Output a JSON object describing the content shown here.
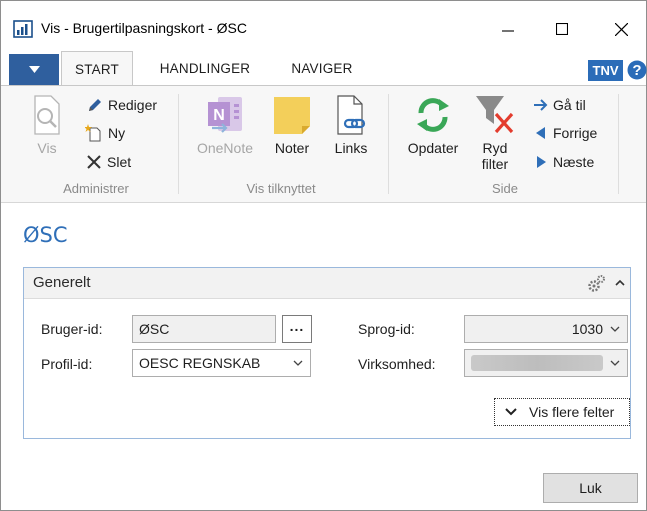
{
  "window": {
    "title": "Vis - Brugertilpasningskort - ØSC",
    "app_icon": "dynamics-nav-icon",
    "controls": [
      "minimize-icon",
      "maximize-icon",
      "close-icon"
    ]
  },
  "ribbon_tabs": {
    "menu_icon": "chevron-down-icon",
    "tabs": [
      {
        "label": "START",
        "active": true
      },
      {
        "label": "HANDLINGER",
        "active": false
      },
      {
        "label": "NAVIGER",
        "active": false
      }
    ],
    "user_initials": "TNV",
    "help_icon": "question-icon"
  },
  "ribbon": {
    "groups": [
      {
        "label": "Administrer",
        "actions": [
          {
            "label": "Vis",
            "icon": "view-magnifier-icon",
            "enabled": false
          },
          {
            "label": "Rediger",
            "icon": "pencil-icon",
            "enabled": true
          },
          {
            "label": "Ny",
            "icon": "new-document-icon",
            "enabled": true
          },
          {
            "label": "Slet",
            "icon": "delete-x-icon",
            "enabled": true
          }
        ]
      },
      {
        "label": "Vis tilknyttet",
        "actions": [
          {
            "label": "OneNote",
            "icon": "onenote-icon",
            "enabled": false
          },
          {
            "label": "Noter",
            "icon": "note-icon",
            "enabled": true
          },
          {
            "label": "Links",
            "icon": "link-document-icon",
            "enabled": true
          }
        ]
      },
      {
        "label": "Side",
        "actions": [
          {
            "label": "Opdater",
            "icon": "refresh-icon",
            "enabled": true
          },
          {
            "label": "Ryd filter",
            "label_line1": "Ryd",
            "label_line2": "filter",
            "icon": "clear-filter-icon",
            "enabled": true
          },
          {
            "label": "Gå til",
            "icon": "arrow-right-icon",
            "enabled": true
          },
          {
            "label": "Forrige",
            "icon": "triangle-left-icon",
            "enabled": true
          },
          {
            "label": "Næste",
            "icon": "triangle-right-icon",
            "enabled": true
          }
        ]
      }
    ]
  },
  "page": {
    "title": "ØSC"
  },
  "fasttab": {
    "title": "Generelt",
    "fields": {
      "bruger_id": {
        "label": "Bruger-id:",
        "value": "ØSC",
        "lookup_label": "..."
      },
      "profil_id": {
        "label": "Profil-id:",
        "value": "OESC REGNSKAB"
      },
      "sprog_id": {
        "label": "Sprog-id:",
        "value": "1030"
      },
      "virksomhed": {
        "label": "Virksomhed:",
        "value_obscured": true
      }
    },
    "more_fields_label": "Vis flere felter"
  },
  "footer": {
    "close_label": "Luk"
  },
  "colors": {
    "accent_blue": "#2f6fb8",
    "menu_blue": "#2f5f9e",
    "refresh_green": "#3aa757",
    "filter_red": "#e33c2e",
    "note_yellow": "#f3cf5a",
    "onenote_purple": "#9b6fbf"
  }
}
